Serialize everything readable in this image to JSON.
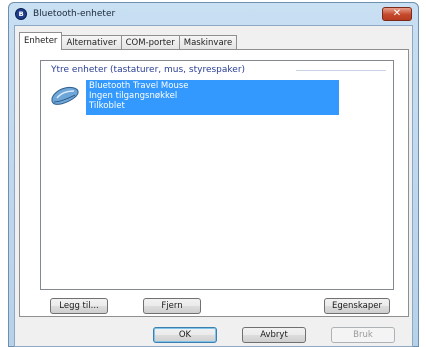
{
  "window": {
    "title": "Bluetooth-enheter",
    "close_label": "✕"
  },
  "tabs": [
    {
      "label": "Enheter",
      "active": true
    },
    {
      "label": "Alternativer",
      "active": false
    },
    {
      "label": "COM-porter",
      "active": false
    },
    {
      "label": "Maskinvare",
      "active": false
    }
  ],
  "device_list": {
    "group_header": "Ytre enheter (tastaturer, mus, styrespaker)",
    "items": [
      {
        "icon": "mouse-icon",
        "name": "Bluetooth Travel Mouse",
        "line2": "Ingen tilgangsnøkkel",
        "line3": "Tilkoblet",
        "selected": true
      }
    ]
  },
  "panel_buttons": {
    "add": "Legg til...",
    "remove": "Fjern",
    "properties": "Egenskaper"
  },
  "dialog_buttons": {
    "ok": "OK",
    "cancel": "Avbryt",
    "apply": "Bruk"
  },
  "colors": {
    "selection": "#3399ff",
    "group_header": "#2a3f94",
    "close_button": "#c4492b"
  }
}
